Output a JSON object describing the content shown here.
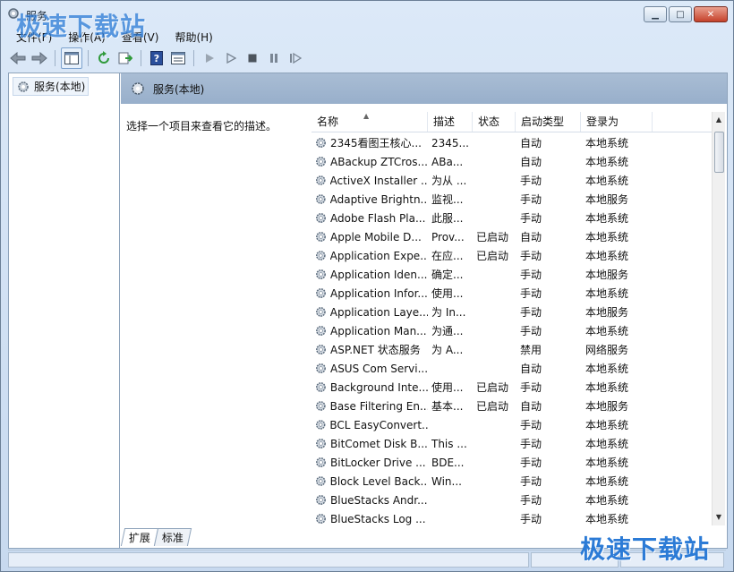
{
  "window": {
    "title": "服务"
  },
  "menu": [
    "文件(F)",
    "操作(A)",
    "查看(V)",
    "帮助(H)"
  ],
  "toolbar_icons": [
    "back-arrow-icon",
    "forward-arrow-icon",
    "show-hide-tree-icon",
    "refresh-icon",
    "export-list-icon",
    "help-icon",
    "properties-icon",
    "start-service-icon",
    "start-service-alt-icon",
    "stop-service-icon",
    "pause-service-icon",
    "restart-service-icon"
  ],
  "tree": {
    "root": "服务(本地)"
  },
  "header": {
    "title": "服务(本地)"
  },
  "description_hint": "选择一个项目来查看它的描述。",
  "columns": [
    "名称",
    "描述",
    "状态",
    "启动类型",
    "登录为"
  ],
  "services": [
    [
      "2345看图王核心...",
      "2345...",
      "",
      "自动",
      "本地系统"
    ],
    [
      "ABackup ZTCros...",
      "ABa...",
      "",
      "自动",
      "本地系统"
    ],
    [
      "ActiveX Installer ...",
      "为从 ...",
      "",
      "手动",
      "本地系统"
    ],
    [
      "Adaptive Brightn...",
      "监视...",
      "",
      "手动",
      "本地服务"
    ],
    [
      "Adobe Flash Pla...",
      "此服...",
      "",
      "手动",
      "本地系统"
    ],
    [
      "Apple Mobile D...",
      "Prov...",
      "已启动",
      "自动",
      "本地系统"
    ],
    [
      "Application Expe...",
      "在应...",
      "已启动",
      "手动",
      "本地系统"
    ],
    [
      "Application Iden...",
      "确定...",
      "",
      "手动",
      "本地服务"
    ],
    [
      "Application Infor...",
      "使用...",
      "",
      "手动",
      "本地系统"
    ],
    [
      "Application Laye...",
      "为 In...",
      "",
      "手动",
      "本地服务"
    ],
    [
      "Application Man...",
      "为通...",
      "",
      "手动",
      "本地系统"
    ],
    [
      "ASP.NET 状态服务",
      "为 A...",
      "",
      "禁用",
      "网络服务"
    ],
    [
      "ASUS Com Servi...",
      "",
      "",
      "自动",
      "本地系统"
    ],
    [
      "Background Inte...",
      "使用...",
      "已启动",
      "手动",
      "本地系统"
    ],
    [
      "Base Filtering En...",
      "基本...",
      "已启动",
      "自动",
      "本地服务"
    ],
    [
      "BCL EasyConvert...",
      "",
      "",
      "手动",
      "本地系统"
    ],
    [
      "BitComet Disk B...",
      "This ...",
      "",
      "手动",
      "本地系统"
    ],
    [
      "BitLocker Drive ...",
      "BDE...",
      "",
      "手动",
      "本地系统"
    ],
    [
      "Block Level Back...",
      "Win...",
      "",
      "手动",
      "本地系统"
    ],
    [
      "BlueStacks Andr...",
      "",
      "",
      "手动",
      "本地系统"
    ],
    [
      "BlueStacks Log ...",
      "",
      "",
      "手动",
      "本地系统"
    ]
  ],
  "tabs": [
    "扩展",
    "标准"
  ],
  "watermark": "极速下载站",
  "colors": {
    "header_band": "#a9bdd4",
    "watermark": "#2c7bd6",
    "close_button": "#c5412b"
  }
}
